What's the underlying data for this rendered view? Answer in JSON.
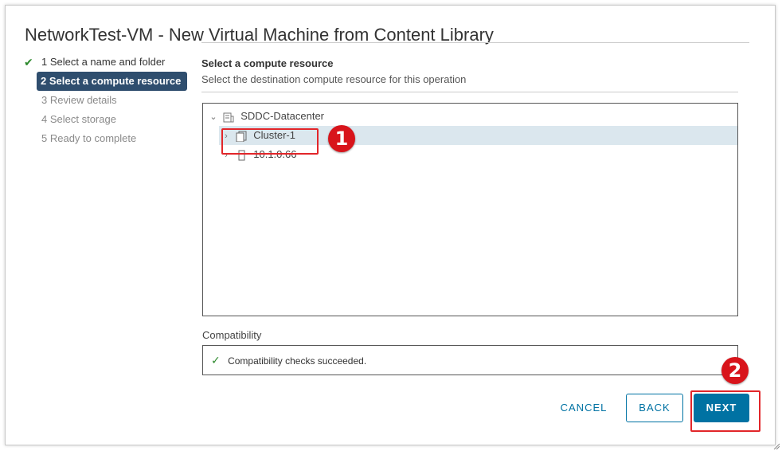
{
  "dialog": {
    "title": "NetworkTest-VM - New Virtual Machine from Content Library"
  },
  "steps": [
    {
      "label": "1 Select a name and folder",
      "state": "done"
    },
    {
      "label": "2 Select a compute resource",
      "state": "active"
    },
    {
      "label": "3 Review details",
      "state": "pending"
    },
    {
      "label": "4 Select storage",
      "state": "pending"
    },
    {
      "label": "5 Ready to complete",
      "state": "pending"
    }
  ],
  "content": {
    "section_title": "Select a compute resource",
    "section_subtitle": "Select the destination compute resource for this operation"
  },
  "tree": {
    "datacenter": {
      "label": "SDDC-Datacenter",
      "icon": "datacenter-icon",
      "expanded": true
    },
    "items": [
      {
        "label": "Cluster-1",
        "icon": "cluster-icon",
        "selected": true
      },
      {
        "label": "10.1.0.66",
        "icon": "host-icon",
        "selected": false
      }
    ]
  },
  "compatibility": {
    "label": "Compatibility",
    "message": "Compatibility checks succeeded."
  },
  "footer": {
    "cancel_label": "CANCEL",
    "back_label": "BACK",
    "next_label": "NEXT"
  },
  "annotations": {
    "marker_1": "1",
    "marker_2": "2"
  },
  "colors": {
    "accent": "#0072a3",
    "active_step_bg": "#2f4e6e",
    "selected_row_bg": "#dbe7ee",
    "success": "#2e8a2e",
    "annotation_red": "#e2262a"
  }
}
